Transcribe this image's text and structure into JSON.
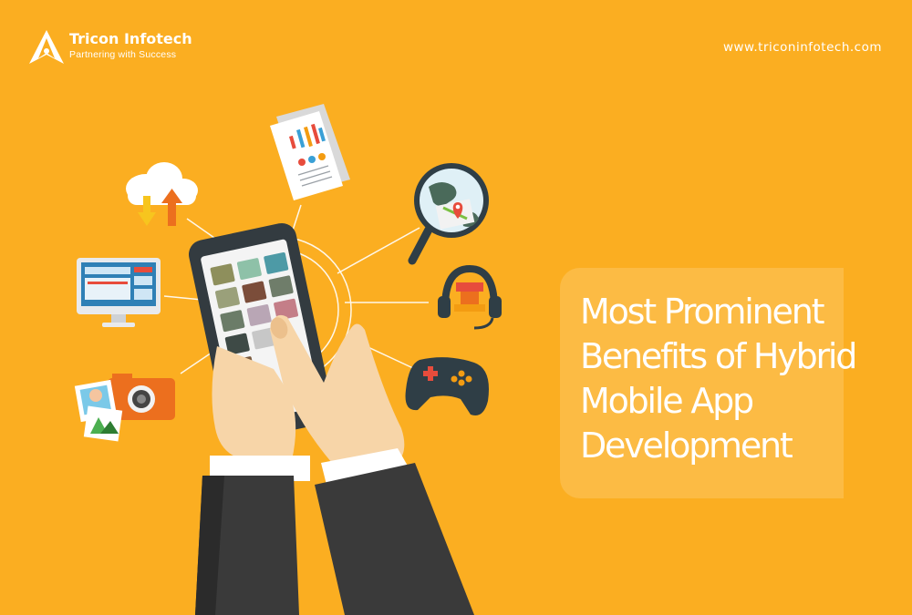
{
  "brand": {
    "name": "Tricon Infotech",
    "tagline": "Partnering with Success",
    "website": "www.triconinfotech.com",
    "logo_icon": "compass-star-icon"
  },
  "headline": {
    "lines": [
      "Most Prominent",
      "Benefits of Hybrid",
      "Mobile App",
      "Development"
    ]
  },
  "illustration": {
    "icons": [
      "cloud-sync-icon",
      "report-document-icon",
      "globe-map-search-icon",
      "desktop-monitor-icon",
      "headphones-icon",
      "camera-photos-icon",
      "gamepad-icon",
      "smartphone-icon",
      "hands-icon"
    ]
  },
  "colors": {
    "background": "#fbae21",
    "panel": "#fcbb44",
    "text": "#ffffff"
  }
}
